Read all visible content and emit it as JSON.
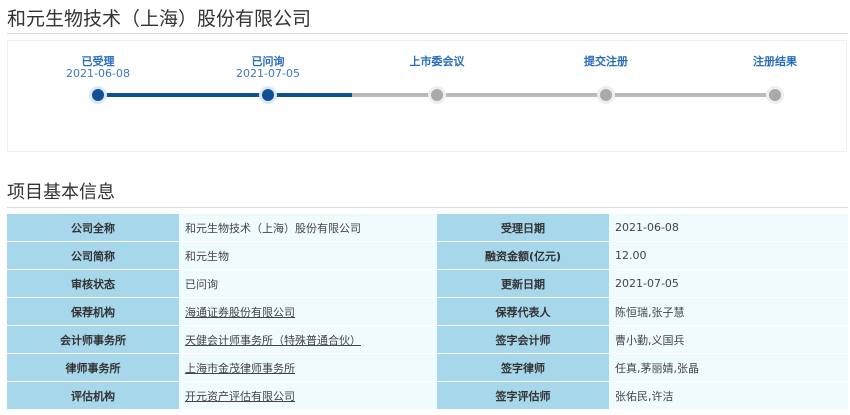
{
  "title": "和元生物技术（上海）股份有限公司",
  "progress": {
    "steps": [
      {
        "label": "已受理",
        "date": "2021-06-08",
        "done": true
      },
      {
        "label": "已问询",
        "date": "2021-07-05",
        "done": true
      },
      {
        "label": "上市委会议",
        "date": "",
        "done": false
      },
      {
        "label": "提交注册",
        "date": "",
        "done": false
      },
      {
        "label": "注册结果",
        "date": "",
        "done": false
      }
    ],
    "colors": {
      "done": "#0f4f94",
      "pending": "#aaaaaa"
    }
  },
  "section_title": "项目基本信息",
  "rows": [
    {
      "k1": "公司全称",
      "v1": "和元生物技术（上海）股份有限公司",
      "k2": "受理日期",
      "v2": "2021-06-08"
    },
    {
      "k1": "公司简称",
      "v1": "和元生物",
      "k2": "融资金额(亿元)",
      "v2": "12.00"
    },
    {
      "k1": "审核状态",
      "v1": "已问询",
      "k2": "更新日期",
      "v2": "2021-07-05"
    },
    {
      "k1": "保荐机构",
      "v1": "海通证券股份有限公司",
      "k2": "保荐代表人",
      "v2": "陈恒瑞,张子慧",
      "link": true
    },
    {
      "k1": "会计师事务所",
      "v1": "天健会计师事务所（特殊普通合伙）",
      "k2": "签字会计师",
      "v2": "曹小勤,义国兵",
      "link": true
    },
    {
      "k1": "律师事务所",
      "v1": "上海市金茂律师事务所",
      "k2": "签字律师",
      "v2": "任真,茅丽婧,张晶",
      "link": true
    },
    {
      "k1": "评估机构",
      "v1": "开元资产评估有限公司",
      "k2": "签字评估师",
      "v2": "张佑民,许洁",
      "link": true
    }
  ]
}
